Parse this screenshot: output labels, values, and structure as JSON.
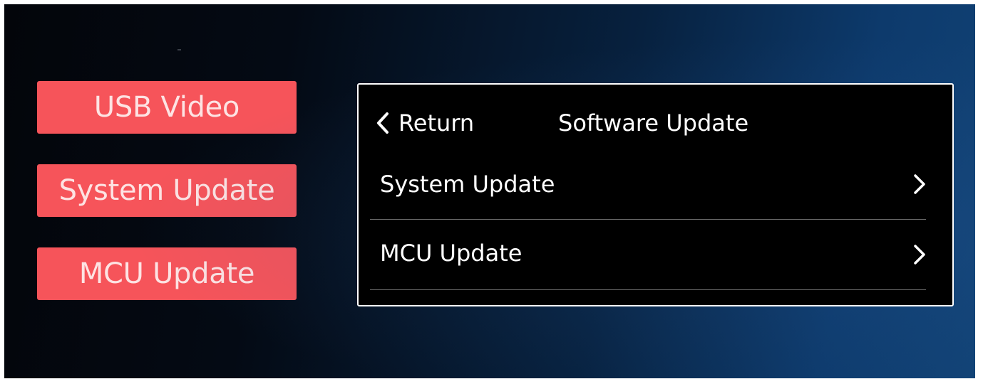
{
  "side_menu": {
    "usb_video": "USB Video",
    "system_update": "System Update",
    "mcu_update": "MCU Update"
  },
  "panel": {
    "return_label": "Return",
    "title": "Software Update",
    "items": [
      {
        "label": "System Update",
        "icon": "chevron-right-icon"
      },
      {
        "label": "MCU Update",
        "icon": "chevron-right-icon"
      }
    ],
    "return_icon": "chevron-left-icon"
  },
  "colors": {
    "button_red": "#f6545a",
    "panel_background": "#000000",
    "panel_border": "#ffffff",
    "divider": "#6d6d6d"
  }
}
